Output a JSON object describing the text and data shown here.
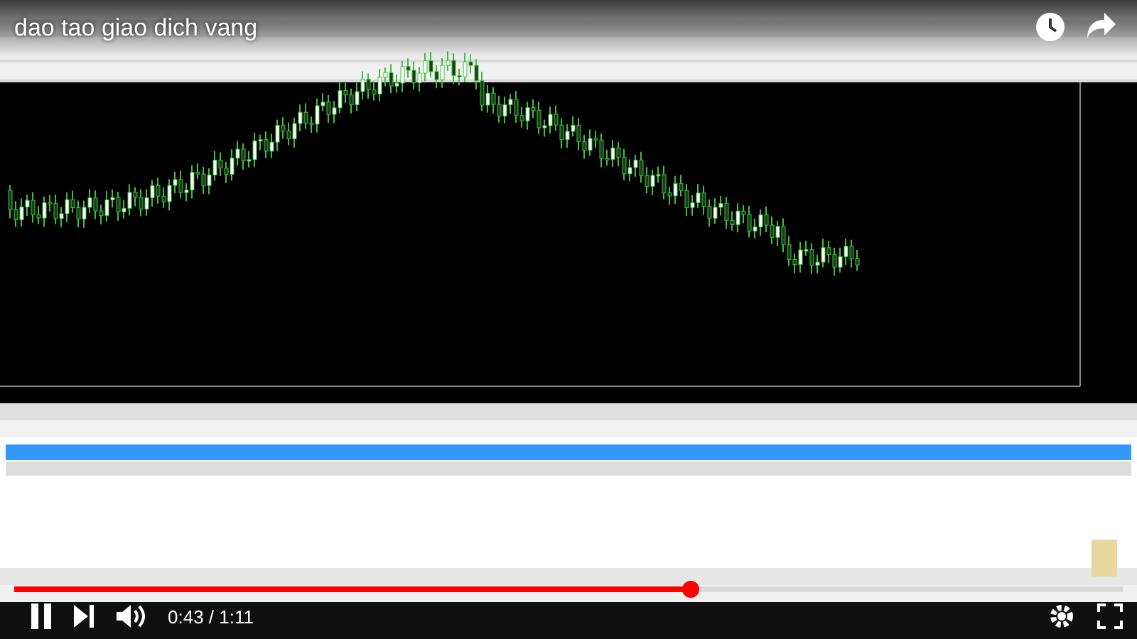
{
  "player": {
    "title": "dao tao giao dich vang",
    "time": "0:43 / 1:11",
    "progress": {
      "level": 0.61
    }
  }
}
